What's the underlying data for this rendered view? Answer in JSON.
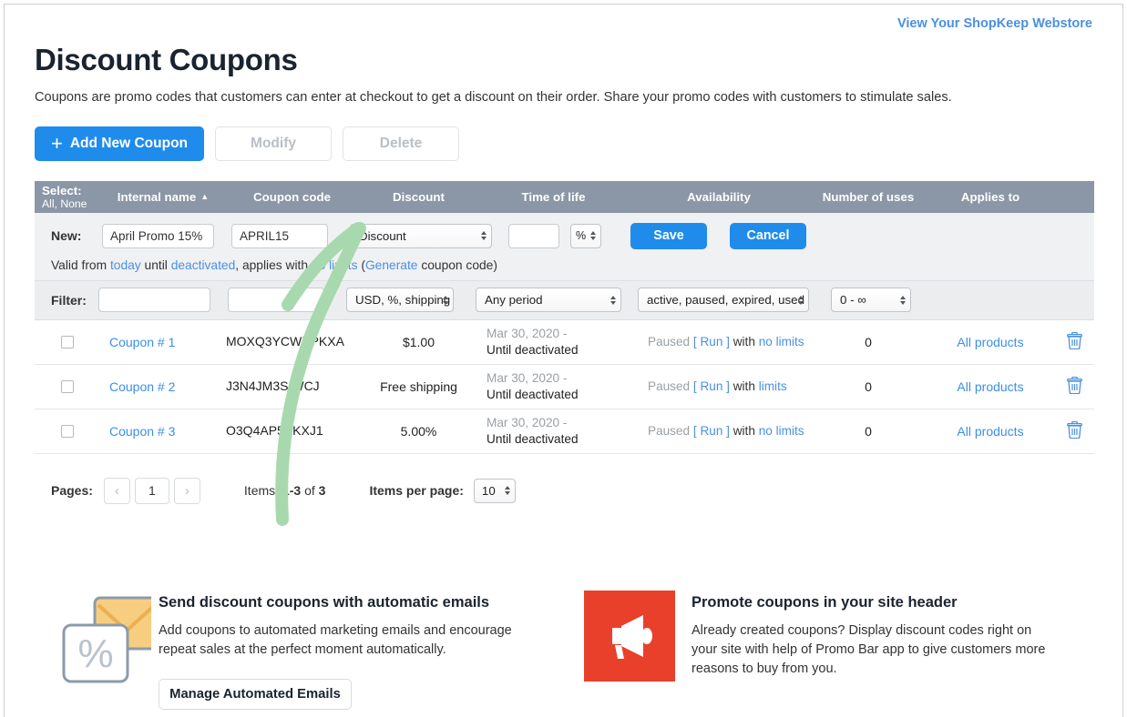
{
  "header": {
    "webstore_link": "View Your ShopKeep Webstore",
    "title": "Discount Coupons",
    "description": "Coupons are promo codes that customers can enter at checkout to get a discount on their order. Share your promo codes with customers to stimulate sales."
  },
  "toolbar": {
    "add_label": "Add New Coupon",
    "add_plus": "+",
    "modify_label": "Modify",
    "delete_label": "Delete"
  },
  "table": {
    "headers": {
      "select": "Select:",
      "select_all": "All",
      "select_sep": ",",
      "select_none": "None",
      "internal_name": "Internal name",
      "sort_caret": "▲",
      "coupon_code": "Coupon code",
      "discount": "Discount",
      "time_of_life": "Time of life",
      "availability": "Availability",
      "number_of_uses": "Number of uses",
      "applies_to": "Applies to"
    },
    "new_row": {
      "label": "New:",
      "name_value": "April Promo 15%",
      "code_value": "APRIL15",
      "discount_type": "Discount",
      "amount_value": "",
      "unit": "%",
      "save_label": "Save",
      "cancel_label": "Cancel",
      "valid_prefix": "Valid from",
      "valid_today": "today",
      "valid_until": "until",
      "valid_deactivated": "deactivated",
      "valid_applies": ", applies with",
      "valid_nolimits": "no limits",
      "generate_open": "(",
      "generate_link": "Generate",
      "generate_tail": "coupon code)"
    },
    "filter_row": {
      "label": "Filter:",
      "name_value": "",
      "code_value": "",
      "discount_value": "USD, %, shipping",
      "period_value": "Any period",
      "availability_value": "active, paused, expired, used",
      "uses_value": "0 - ∞"
    },
    "rows": [
      {
        "name": "Coupon # 1",
        "code": "MOXQ3YCWXPKXA",
        "discount": "$1.00",
        "life_from": "Mar 30, 2020",
        "life_dash": "-",
        "life_until": "Until deactivated",
        "status": "Paused",
        "run": "[ Run ]",
        "with": "with",
        "limits": "no limits",
        "uses": "0",
        "applies_to": "All products"
      },
      {
        "name": "Coupon # 2",
        "code": "J3N4JM3SIWCJ",
        "discount": "Free shipping",
        "life_from": "Mar 30, 2020",
        "life_dash": "-",
        "life_until": "Until deactivated",
        "status": "Paused",
        "run": "[ Run ]",
        "with": "with",
        "limits": "limits",
        "uses": "0",
        "applies_to": "All products"
      },
      {
        "name": "Coupon # 3",
        "code": "O3Q4AP5KKXJ1",
        "discount": "5.00%",
        "life_from": "Mar 30, 2020",
        "life_dash": "-",
        "life_until": "Until deactivated",
        "status": "Paused",
        "run": "[ Run ]",
        "with": "with",
        "limits": "no limits",
        "uses": "0",
        "applies_to": "All products"
      }
    ]
  },
  "pagination": {
    "pages_label": "Pages:",
    "prev": "‹",
    "current_page": "1",
    "next": "›",
    "items_label": "Items:",
    "items_range": "1-3",
    "items_of": "of",
    "items_total": "3",
    "per_page_label": "Items per page:",
    "per_page_value": "10"
  },
  "promos": [
    {
      "title": "Send discount coupons with automatic emails",
      "body": "Add coupons to automated marketing emails and encourage repeat sales at the perfect moment automatically.",
      "button": "Manage Automated Emails"
    },
    {
      "title": "Promote coupons in your site header",
      "body": "Already created coupons? Display discount codes right on your site with help of Promo Bar app to give customers more reasons to buy from you."
    }
  ],
  "colors": {
    "accent_blue": "#1f8ceb",
    "link_blue": "#3b8fe8",
    "header_gray": "#8b97a6",
    "promo_red": "#e8402a",
    "annotation_green": "#a8d9ae"
  }
}
